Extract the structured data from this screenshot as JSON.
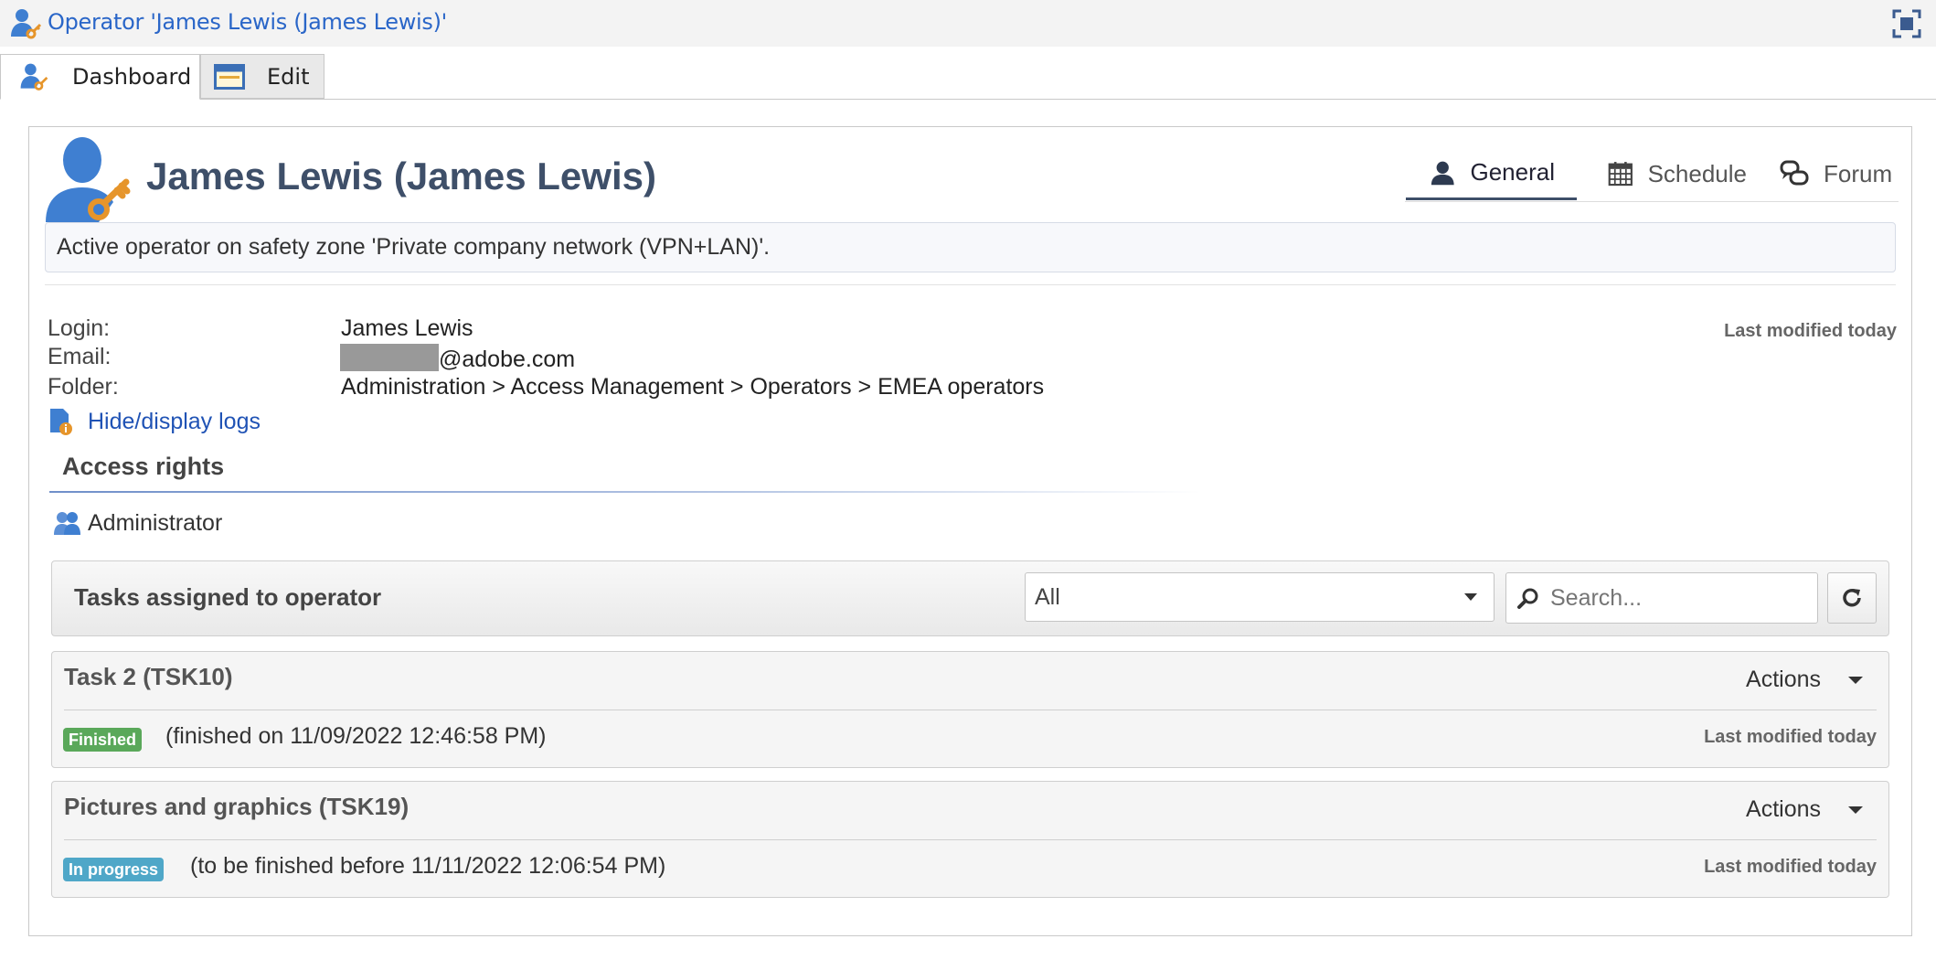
{
  "window": {
    "title": "Operator 'James Lewis (James Lewis)'",
    "icon": "operator-icon",
    "maximize_icon": "maximize-icon"
  },
  "tabs": [
    {
      "label": "Dashboard",
      "icon": "operator-icon",
      "active": true
    },
    {
      "label": "Edit",
      "icon": "form-icon",
      "active": false
    }
  ],
  "header": {
    "operator_name": "James Lewis (James Lewis)",
    "view_tabs": [
      {
        "label": "General",
        "icon": "person-icon",
        "active": true
      },
      {
        "label": "Schedule",
        "icon": "calendar-icon",
        "active": false
      },
      {
        "label": "Forum",
        "icon": "chat-icon",
        "active": false
      }
    ]
  },
  "status_message": "Active operator on safety zone 'Private company network (VPN+LAN)'.",
  "details": {
    "login_label": "Login:",
    "login_value": "James Lewis",
    "email_label": "Email:",
    "email_domain": "@adobe.com",
    "folder_label": "Folder:",
    "folder_value": "Administration > Access Management > Operators > EMEA operators",
    "last_modified": "Last modified today"
  },
  "logs_link": "Hide/display logs",
  "access_rights": {
    "title": "Access rights",
    "roles": [
      "Administrator"
    ]
  },
  "tasks": {
    "header_label": "Tasks assigned to operator",
    "filter_value": "All",
    "search_placeholder": "Search...",
    "items": [
      {
        "title": "Task 2 (TSK10)",
        "actions_label": "Actions",
        "status": "Finished",
        "detail": "(finished on 11/09/2022 12:46:58 PM)",
        "last_modified": "Last modified today"
      },
      {
        "title": "Pictures and graphics (TSK19)",
        "actions_label": "Actions",
        "status": "In progress",
        "detail": "(to be finished before 11/11/2022 12:06:54 PM)",
        "last_modified": "Last modified today"
      }
    ]
  },
  "colors": {
    "link": "#2053b5",
    "title_blue": "#2a66c8",
    "operator_icon": "#3f7fd1",
    "key_orange": "#e6952b",
    "badge_finished": "#5aa85a",
    "badge_in_progress": "#4fa7c8"
  }
}
